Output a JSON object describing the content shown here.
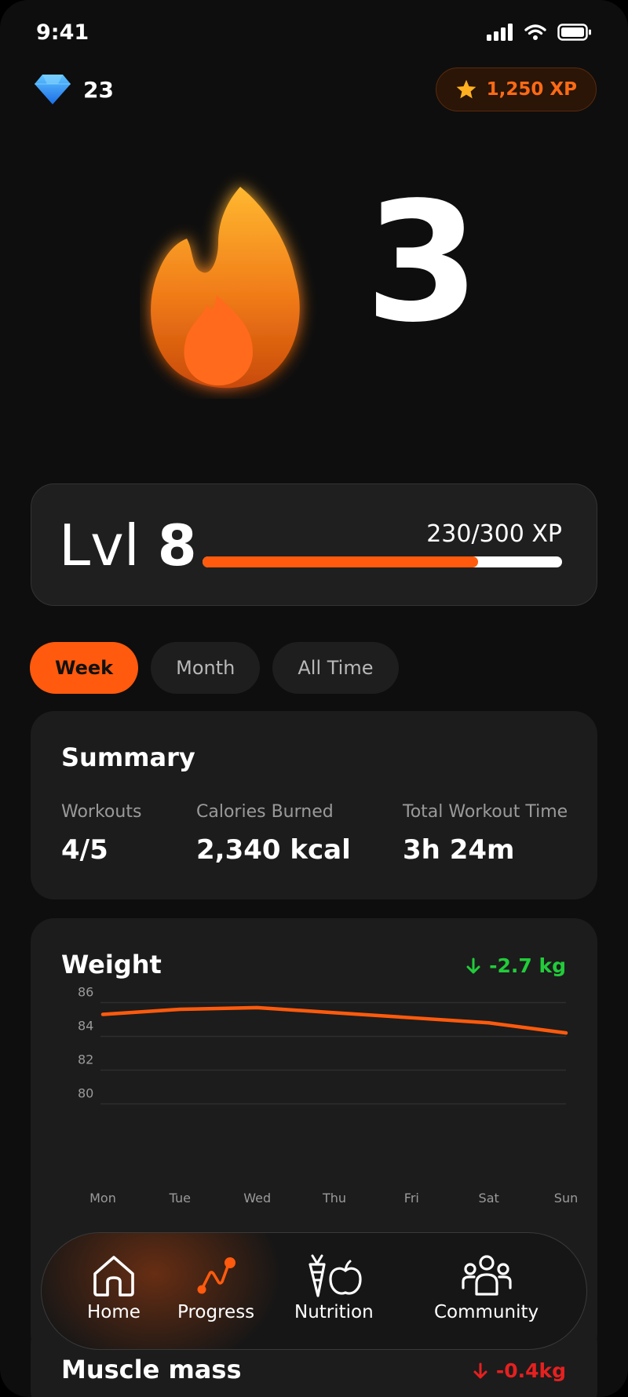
{
  "status_bar": {
    "time": "9:41"
  },
  "header": {
    "gems": "23",
    "xp": "1,250 XP"
  },
  "streak": {
    "count": "3"
  },
  "level": {
    "prefix": "Lvl",
    "number": "8",
    "progress_text": "230/300 XP",
    "progress_fraction": 0.767
  },
  "tabs": [
    {
      "label": "Week",
      "active": true
    },
    {
      "label": "Month",
      "active": false
    },
    {
      "label": "All Time",
      "active": false
    }
  ],
  "summary": {
    "title": "Summary",
    "stats": [
      {
        "label": "Workouts",
        "value": "4/5"
      },
      {
        "label": "Calories Burned",
        "value": "2,340 kcal"
      },
      {
        "label": "Total Workout Time",
        "value": "3h 24m"
      }
    ]
  },
  "weight": {
    "title": "Weight",
    "delta": "-2.7 kg"
  },
  "chart_data": {
    "type": "line",
    "title": "Weight",
    "categories": [
      "Mon",
      "Tue",
      "Wed",
      "Thu",
      "Fri",
      "Sat",
      "Sun"
    ],
    "x": [
      "Mon",
      "Tue",
      "Wed",
      "Thu",
      "Fri",
      "Sat",
      "Sun"
    ],
    "series": [
      {
        "values": [
          85.3,
          85.6,
          85.7,
          85.4,
          85.1,
          84.8,
          84.2
        ]
      }
    ],
    "y_ticks": [
      "86",
      "84",
      "82",
      "80"
    ],
    "ylim": [
      79,
      86.3
    ],
    "grid": true,
    "line_color": "#ff5a0d"
  },
  "muscle": {
    "title": "Muscle mass",
    "delta": "-0.4kg"
  },
  "nav": [
    {
      "label": "Home",
      "icon": "home-icon"
    },
    {
      "label": "Progress",
      "icon": "progress-icon"
    },
    {
      "label": "Nutrition",
      "icon": "nutrition-icon"
    },
    {
      "label": "Community",
      "icon": "community-icon"
    }
  ],
  "colors": {
    "accent": "#ff5a0d",
    "positive": "#22cc3a",
    "negative": "#e62020"
  }
}
